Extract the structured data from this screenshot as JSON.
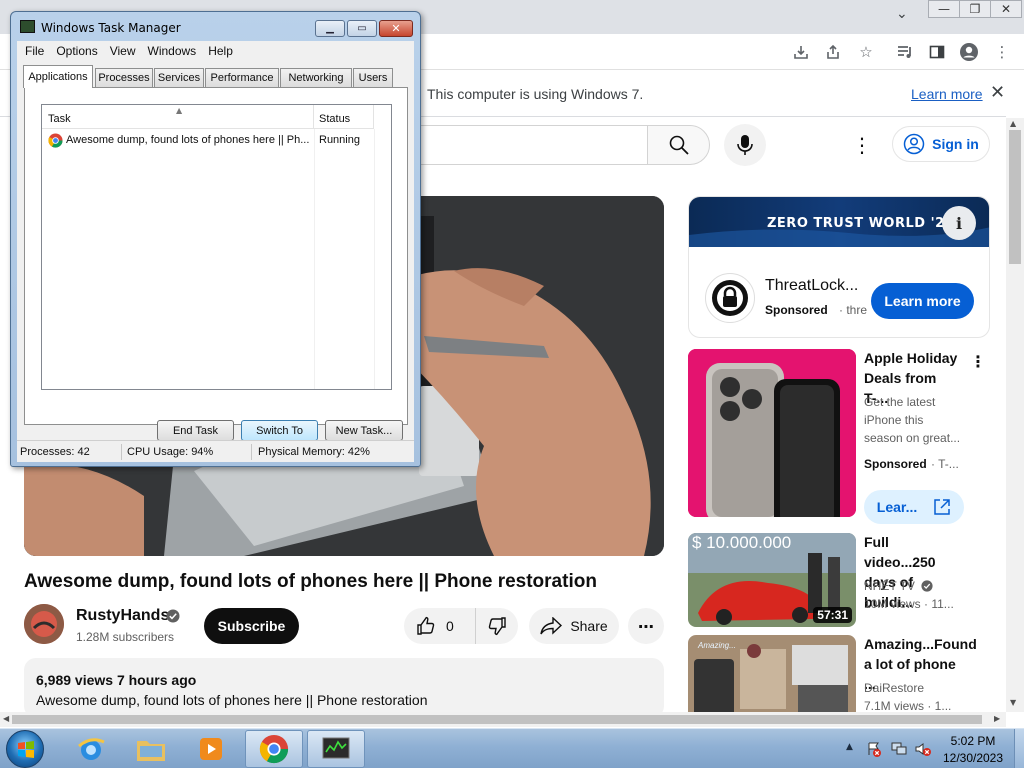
{
  "browser": {
    "infobar": {
      "message": "This computer is using Windows 7.",
      "learn_more": "Learn more"
    },
    "toolbar_icons": [
      "install-icon",
      "share-icon",
      "star-icon",
      "media-queue-icon",
      "side-panel-icon",
      "profile-icon",
      "more-vert-icon"
    ]
  },
  "youtube": {
    "header": {
      "sign_in": "Sign in"
    },
    "video": {
      "title": "Awesome dump, found lots of phones here || Phone restoration",
      "channel": "RustyHands",
      "subscribers": "1.28M subscribers",
      "subscribe": "Subscribe",
      "likes": "0",
      "share": "Share",
      "views_meta": "6,989 views  7 hours ago",
      "description": "Awesome dump, found lots of phones here || Phone restoration"
    },
    "ad": {
      "banner_title": "ZERO TRUST WORLD '24",
      "name": "ThreatLock...",
      "sponsored": "Sponsored",
      "domain": "· thre",
      "cta": "Learn more"
    },
    "recommendations": [
      {
        "title": "Apple Holiday Deals from T-...",
        "desc": "Get the latest iPhone this season on great...",
        "sponsored": "Sponsored",
        "extra": "· T-...",
        "cta": "Lear..."
      },
      {
        "title": "Full video...250 days of buildi...",
        "channel": "NHẾT TV",
        "meta": "10M views  · 11...",
        "duration": "57:31",
        "overlay": "$ 10.000.000"
      },
      {
        "title": "Amazing...Found a lot of phone ...",
        "channel": "DaiRestore",
        "meta": "7.1M views  · 1...",
        "overlay": "Amazing..."
      }
    ]
  },
  "task_manager": {
    "title": "Windows Task Manager",
    "menu": [
      "File",
      "Options",
      "View",
      "Windows",
      "Help"
    ],
    "tabs": [
      "Applications",
      "Processes",
      "Services",
      "Performance",
      "Networking",
      "Users"
    ],
    "columns": {
      "task": "Task",
      "status": "Status"
    },
    "rows": [
      {
        "task": "Awesome dump, found lots of phones here || Ph...",
        "status": "Running"
      }
    ],
    "buttons": {
      "end_task": "End Task",
      "switch_to": "Switch To",
      "new_task": "New Task..."
    },
    "status": {
      "processes": "Processes: 42",
      "cpu": "CPU Usage: 94%",
      "memory": "Physical Memory: 42%"
    }
  },
  "taskbar": {
    "apps": [
      "internet-explorer-icon",
      "windows-explorer-icon",
      "media-player-icon",
      "chrome-icon",
      "task-manager-icon"
    ],
    "time": "5:02 PM",
    "date": "12/30/2023"
  }
}
